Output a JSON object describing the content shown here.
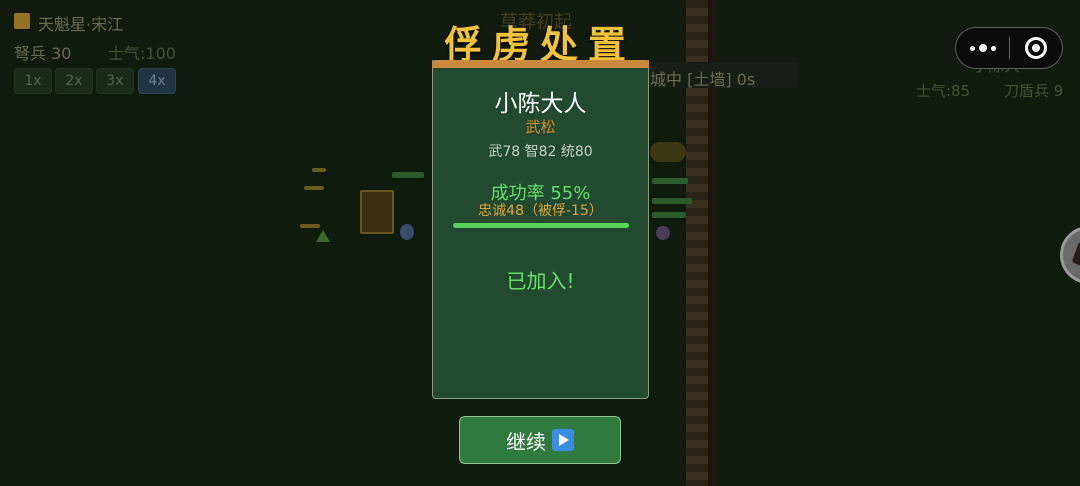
{
  "background": {
    "player_name": "天魁星·宋江",
    "player_troops": "弩兵 30",
    "player_morale": "士气:100",
    "speed_buttons": [
      "1x",
      "2x",
      "3x",
      "4x"
    ],
    "active_speed": "4x",
    "ghost_title": "草莽初起",
    "siege_status": "城中 [土墙] 0s",
    "enemy_name": "小陈大",
    "enemy_morale": "士气:85",
    "enemy_troops": "刀盾兵 9"
  },
  "dialog": {
    "title": "俘虏处置",
    "officer_name": "小陈大人",
    "general_name": "武松",
    "stats": "武78 智82 统80",
    "success_rate": "成功率 55%",
    "loyalty": "忠诚48（被俘-15）",
    "success_progress": 1.0,
    "result_text": "已加入!",
    "continue_label": "继续"
  },
  "icons": {
    "continue": "play-icon",
    "capsule_more": "more-dots-icon",
    "capsule_close": "close-circle-icon"
  },
  "colors": {
    "title_gold": "#f2c33a",
    "panel_green": "#214a30",
    "success_green": "#5fe062",
    "general_orange": "#d98a2f",
    "button_green": "#2f7a3f"
  }
}
